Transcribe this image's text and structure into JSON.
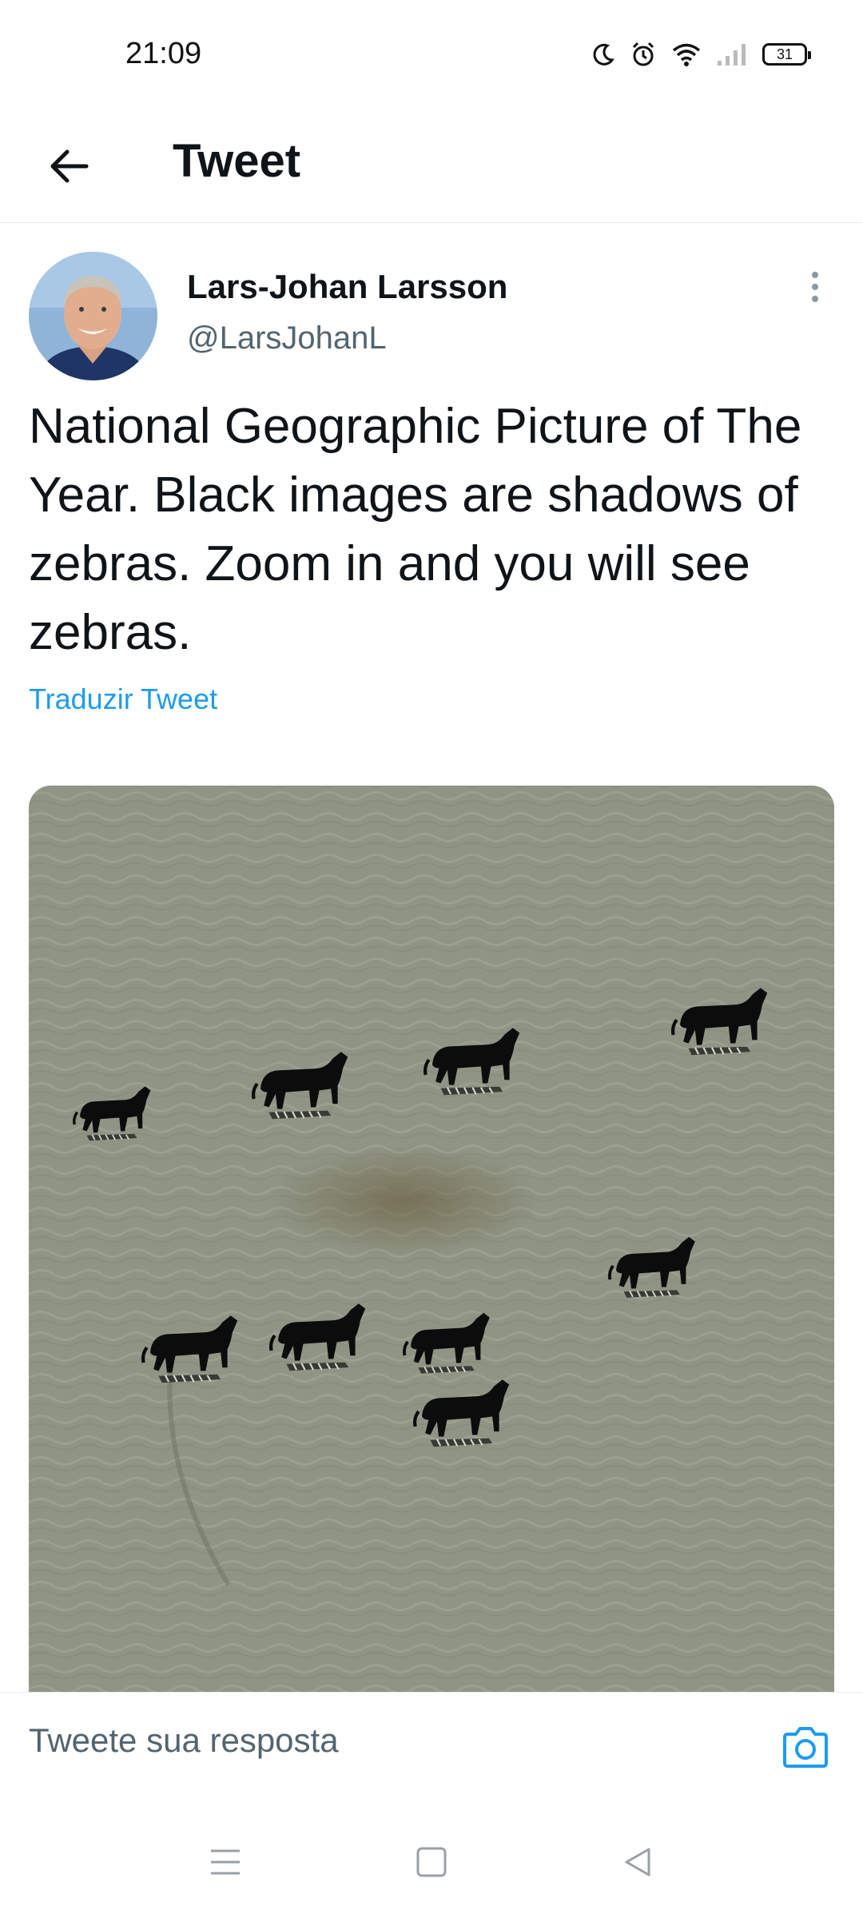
{
  "status_bar": {
    "time": "21:09",
    "battery_level": "31",
    "icons": [
      "moon-icon",
      "alarm-icon",
      "wifi-icon",
      "signal-icon",
      "battery-icon"
    ]
  },
  "header": {
    "title": "Tweet",
    "back_icon": "arrow-left-icon"
  },
  "tweet": {
    "author_name": "Lars-Johan Larsson",
    "author_handle": "@LarsJohanL",
    "text": "National Geographic Picture of The Year. Black images are shadows of zebras. Zoom in and you will see zebras.",
    "translate_label": "Traduzir Tweet",
    "more_icon": "more-vertical-icon"
  },
  "reply": {
    "placeholder": "Tweete sua resposta",
    "camera_icon": "camera-icon"
  },
  "nav_bar": {
    "icons": [
      "menu-icon",
      "home-square-icon",
      "back-triangle-icon"
    ]
  },
  "colors": {
    "accent": "#1d9bf0",
    "text_primary": "#0f1419",
    "text_secondary": "#536471",
    "water": "#8f9484"
  }
}
